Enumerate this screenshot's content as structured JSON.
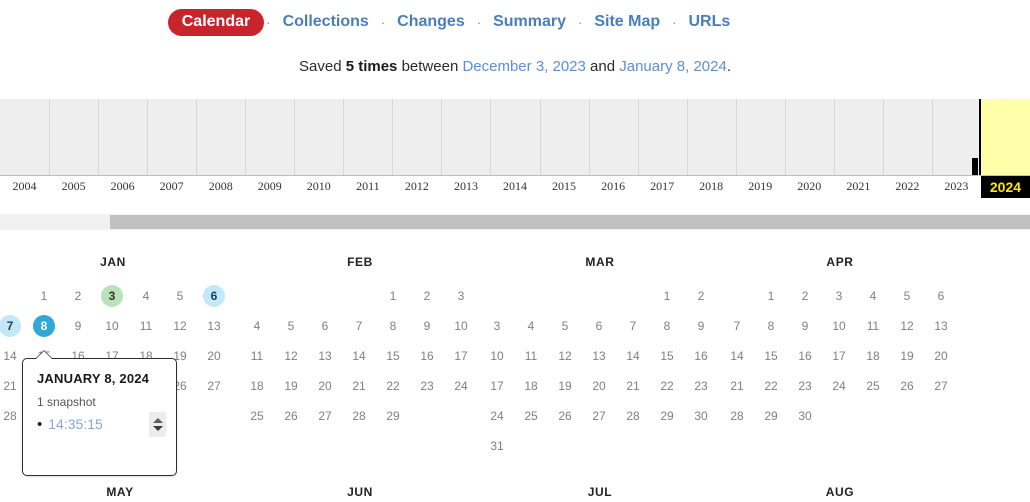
{
  "nav": {
    "separator": "·",
    "tabs": [
      {
        "label": "Calendar",
        "active": true
      },
      {
        "label": "Collections",
        "active": false
      },
      {
        "label": "Changes",
        "active": false
      },
      {
        "label": "Summary",
        "active": false
      },
      {
        "label": "Site Map",
        "active": false
      },
      {
        "label": "URLs",
        "active": false
      }
    ]
  },
  "summary": {
    "prefix": "Saved ",
    "count": "5 times",
    "middle": " between ",
    "start_date": "December 3, 2023",
    "conjunction": " and ",
    "end_date": "January 8, 2024",
    "suffix": "."
  },
  "timeline": {
    "years": [
      "2004",
      "2005",
      "2006",
      "2007",
      "2008",
      "2009",
      "2010",
      "2011",
      "2012",
      "2013",
      "2014",
      "2015",
      "2016",
      "2017",
      "2018",
      "2019",
      "2020",
      "2021",
      "2022",
      "2023",
      "2024"
    ],
    "current_year": "2024",
    "current_year_color": "#ffe600",
    "current_cell_color": "#ffffaa",
    "bars": [
      {
        "year": "2023",
        "height_pct": 22
      }
    ]
  },
  "scrollbar": {
    "orientation": "horizontal",
    "thumb_left_pct": 10.7,
    "thumb_width_pct": 89.3
  },
  "calendar": {
    "year": "2024",
    "months": [
      {
        "name": "JAN",
        "first_weekday": 1,
        "days": 31,
        "marked": [
          {
            "day": 3,
            "style": "green"
          },
          {
            "day": 6,
            "style": "blue"
          },
          {
            "day": 7,
            "style": "blue"
          },
          {
            "day": 8,
            "style": "sel"
          }
        ]
      },
      {
        "name": "FEB",
        "first_weekday": 4,
        "days": 29,
        "marked": []
      },
      {
        "name": "MAR",
        "first_weekday": 5,
        "days": 31,
        "marked": []
      },
      {
        "name": "APR",
        "first_weekday": 1,
        "days": 30,
        "marked": []
      }
    ],
    "next_row_months": [
      "MAY",
      "JUN",
      "JUL",
      "AUG"
    ]
  },
  "tooltip": {
    "title": "JANUARY 8, 2024",
    "count": "1 snapshot",
    "bullet": "•",
    "snapshots": [
      "14:35:15"
    ]
  }
}
